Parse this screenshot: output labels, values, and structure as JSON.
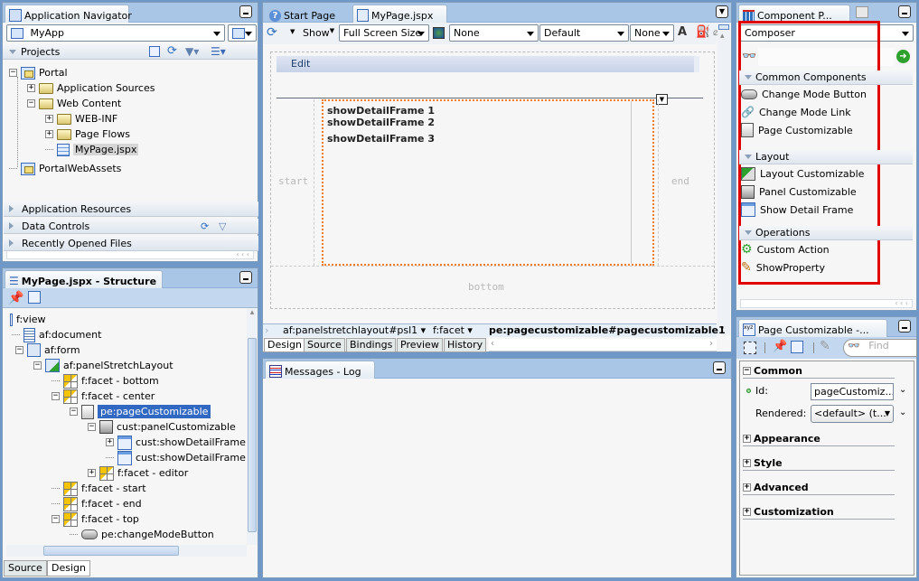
{
  "app_navigator": {
    "title": "Application Navigator",
    "app_select": "MyApp",
    "projects_label": "Projects",
    "tree": [
      {
        "label": "Portal",
        "level": 0,
        "icon": "project-folder-icon",
        "expander": "-"
      },
      {
        "label": "Application Sources",
        "level": 1,
        "icon": "folder-icon",
        "expander": "+"
      },
      {
        "label": "Web Content",
        "level": 1,
        "icon": "folder-icon",
        "expander": "-"
      },
      {
        "label": "WEB-INF",
        "level": 2,
        "icon": "folder-icon",
        "expander": "+"
      },
      {
        "label": "Page Flows",
        "level": 2,
        "icon": "folder-icon",
        "expander": "+"
      },
      {
        "label": "MyPage.jspx",
        "level": 2,
        "icon": "jspx-file-icon",
        "expander": "",
        "selected": true
      },
      {
        "label": "PortalWebAssets",
        "level": 0,
        "icon": "project-folder-icon",
        "expander": ""
      }
    ],
    "accordions": [
      "Application Resources",
      "Data Controls",
      "Recently Opened Files"
    ]
  },
  "structure": {
    "title": "MyPage.jspx - Structure",
    "tree": [
      {
        "label": "f:view",
        "level": 0,
        "icon": "",
        "expander": ""
      },
      {
        "label": "af:document",
        "level": 0,
        "icon": "document-icon",
        "expander": ""
      },
      {
        "label": "af:form",
        "level": 1,
        "icon": "form-icon",
        "expander": "-"
      },
      {
        "label": "af:panelStretchLayout",
        "level": 2,
        "icon": "panel-stretch-layout-icon",
        "expander": "-"
      },
      {
        "label": "f:facet - bottom",
        "level": 3,
        "icon": "facet-icon",
        "expander": ""
      },
      {
        "label": "f:facet - center",
        "level": 3,
        "icon": "facet-icon",
        "expander": "-"
      },
      {
        "label": "pe:pageCustomizable",
        "level": 4,
        "icon": "page-customizable-icon",
        "expander": "-",
        "selected": true
      },
      {
        "label": "cust:panelCustomizable",
        "level": 5,
        "icon": "panel-customizable-icon",
        "expander": "-"
      },
      {
        "label": "cust:showDetailFrame",
        "level": 6,
        "icon": "show-detail-frame-icon",
        "expander": "+"
      },
      {
        "label": "cust:showDetailFrame",
        "level": 6,
        "icon": "show-detail-frame-icon",
        "expander": ""
      },
      {
        "label": "f:facet - editor",
        "level": 5,
        "icon": "facet-icon",
        "expander": "+"
      },
      {
        "label": "f:facet - start",
        "level": 3,
        "icon": "facet-icon",
        "expander": ""
      },
      {
        "label": "f:facet - end",
        "level": 3,
        "icon": "facet-icon",
        "expander": ""
      },
      {
        "label": "f:facet - top",
        "level": 3,
        "icon": "facet-icon",
        "expander": "-"
      },
      {
        "label": "pe:changeModeButton",
        "level": 4,
        "icon": "button-icon",
        "expander": ""
      }
    ],
    "bottom_tabs": [
      "Source",
      "Design"
    ],
    "active_bottom_tab": "Design"
  },
  "editor": {
    "tabs": [
      {
        "label": "Start Page",
        "active": false
      },
      {
        "label": "MyPage.jspx",
        "active": true
      }
    ],
    "toolbar": {
      "show_label": "Show",
      "size_select": "Full Screen Size",
      "select1": "None",
      "select2": "Default",
      "select3": "None"
    },
    "canvas": {
      "edit_label": "Edit",
      "frames": [
        "showDetailFrame 1",
        "showDetailFrame 2",
        "showDetailFrame 3"
      ],
      "start_label": "start",
      "end_label": "end",
      "bottom_label": "bottom"
    },
    "breadcrumbs": [
      "af:panelstretchlayout#psl1",
      "f:facet",
      "pe:pagecustomizable#pagecustomizable1"
    ],
    "bottom_tabs": [
      "Design",
      "Source",
      "Bindings",
      "Preview",
      "History"
    ],
    "active_bottom_tab": "Design"
  },
  "messages": {
    "title": "Messages - Log"
  },
  "palette": {
    "title": "Component P...",
    "library_select": "Composer",
    "search_value": "",
    "sections": [
      {
        "name": "Common Components",
        "items": [
          {
            "label": "Change Mode Button",
            "icon": "button-icon"
          },
          {
            "label": "Change Mode Link",
            "icon": "link-icon"
          },
          {
            "label": "Page Customizable",
            "icon": "page-customizable-icon"
          }
        ]
      },
      {
        "name": "Layout",
        "items": [
          {
            "label": "Layout Customizable",
            "icon": "layout-customizable-icon"
          },
          {
            "label": "Panel Customizable",
            "icon": "panel-customizable-icon"
          },
          {
            "label": "Show Detail Frame",
            "icon": "show-detail-frame-icon"
          }
        ]
      },
      {
        "name": "Operations",
        "items": [
          {
            "label": "Custom Action",
            "icon": "custom-action-icon"
          },
          {
            "label": "ShowProperty",
            "icon": "show-property-icon"
          }
        ]
      }
    ],
    "highlight_color": "#e00000"
  },
  "inspector": {
    "title": "Page Customizable -...",
    "find_placeholder": "Find",
    "common_label": "Common",
    "id_label": "Id:",
    "id_value": "pageCustomiz...",
    "rendered_label": "Rendered:",
    "rendered_value": "<default> (t...",
    "sections": [
      "Appearance",
      "Style",
      "Advanced",
      "Customization"
    ]
  }
}
